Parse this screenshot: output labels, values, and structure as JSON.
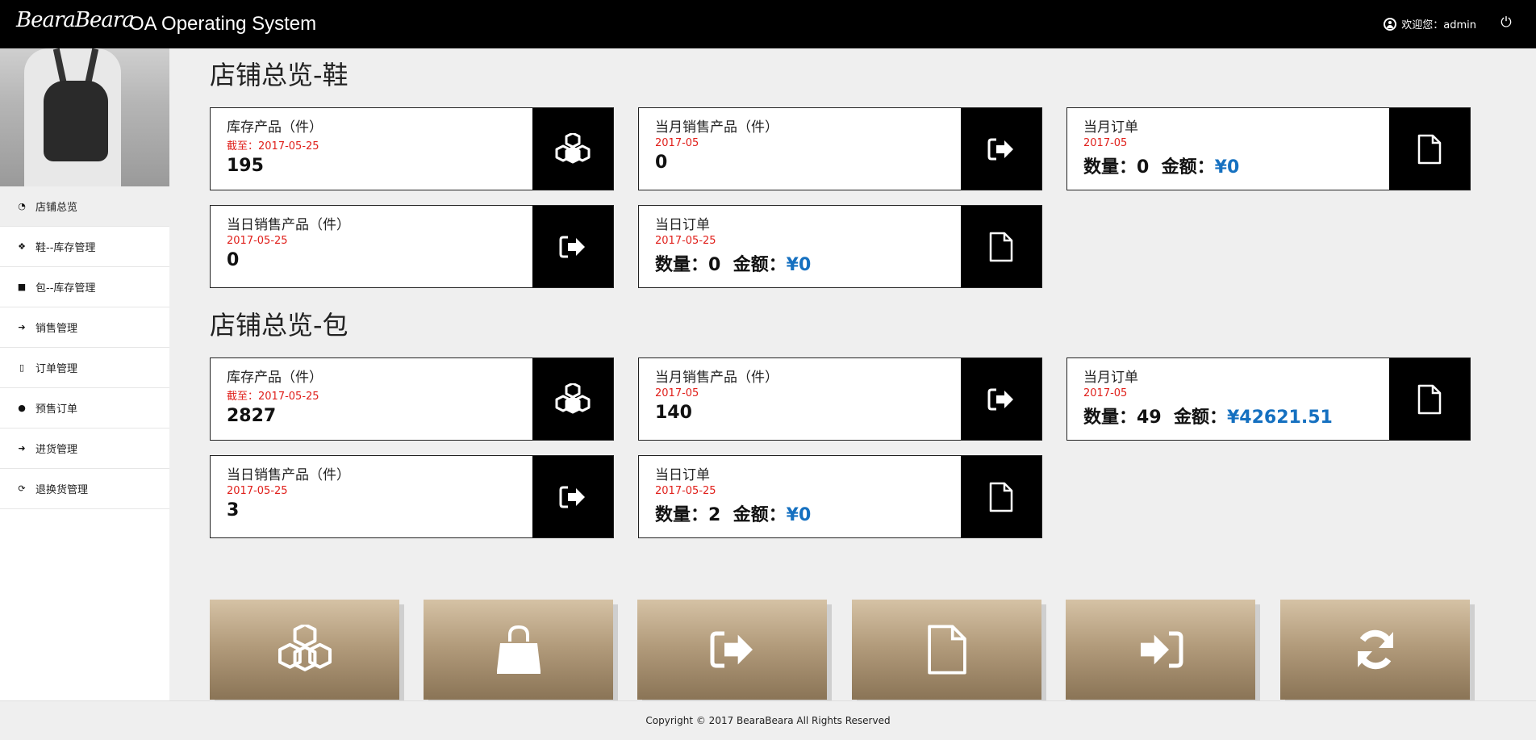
{
  "header": {
    "brand_script": "BearaBeara",
    "brand_text": "OA Operating System",
    "welcome": "欢迎您：admin"
  },
  "sidebar": {
    "items": [
      {
        "label": "店铺总览",
        "icon": "dashboard-icon"
      },
      {
        "label": "鞋--库存管理",
        "icon": "cubes-icon"
      },
      {
        "label": "包--库存管理",
        "icon": "bag-icon"
      },
      {
        "label": "销售管理",
        "icon": "sign-out-icon"
      },
      {
        "label": "订单管理",
        "icon": "file-icon"
      },
      {
        "label": "预售订单",
        "icon": "globe-icon"
      },
      {
        "label": "进货管理",
        "icon": "sign-in-icon"
      },
      {
        "label": "退换货管理",
        "icon": "refresh-icon"
      }
    ]
  },
  "shoes": {
    "title": "店铺总览-鞋",
    "stock": {
      "title": "库存产品（件）",
      "date": "截至：2017-05-25",
      "value": "195"
    },
    "month_sales": {
      "title": "当月销售产品（件）",
      "date": "2017-05",
      "value": "0"
    },
    "month_orders": {
      "title": "当月订单",
      "date": "2017-05",
      "qty_label": "数量：",
      "qty": "0",
      "amt_label": "金额：",
      "amt": "¥0"
    },
    "day_sales": {
      "title": "当日销售产品（件）",
      "date": "2017-05-25",
      "value": "0"
    },
    "day_orders": {
      "title": "当日订单",
      "date": "2017-05-25",
      "qty_label": "数量：",
      "qty": "0",
      "amt_label": "金额：",
      "amt": "¥0"
    }
  },
  "bags": {
    "title": "店铺总览-包",
    "stock": {
      "title": "库存产品（件）",
      "date": "截至：2017-05-25",
      "value": "2827"
    },
    "month_sales": {
      "title": "当月销售产品（件）",
      "date": "2017-05",
      "value": "140"
    },
    "month_orders": {
      "title": "当月订单",
      "date": "2017-05",
      "qty_label": "数量：",
      "qty": "49",
      "amt_label": "金额：",
      "amt": "¥42621.51"
    },
    "day_sales": {
      "title": "当日销售产品（件）",
      "date": "2017-05-25",
      "value": "3"
    },
    "day_orders": {
      "title": "当日订单",
      "date": "2017-05-25",
      "qty_label": "数量：",
      "qty": "2",
      "amt_label": "金额：",
      "amt": "¥0"
    }
  },
  "tiles": [
    "cubes-icon",
    "shopping-bag-icon",
    "sign-out-icon",
    "file-icon",
    "sign-in-icon",
    "refresh-icon"
  ],
  "footer": {
    "copyright": "Copyright © 2017 BearaBeara All Rights Reserved"
  },
  "colors": {
    "accent_red": "#e0201b",
    "amount_blue": "#1570c0",
    "tile_gold": "#b39c7c"
  }
}
